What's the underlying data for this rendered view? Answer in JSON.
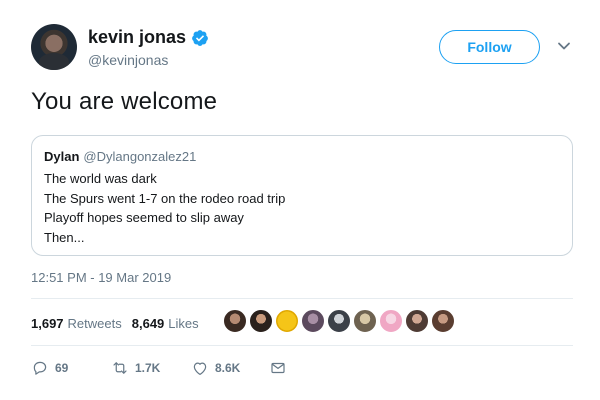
{
  "tweet": {
    "author": {
      "display_name": "kevin jonas",
      "handle": "@kevinjonas",
      "verified_icon": "verified-badge-icon"
    },
    "follow_label": "Follow",
    "text": "You are welcome",
    "quoted": {
      "display_name": "Dylan",
      "handle": "@Dylangonzalez21",
      "lines": [
        "The world was dark",
        "The Spurs went 1-7 on the rodeo road trip",
        "Playoff hopes seemed to slip away",
        "Then..."
      ]
    },
    "timestamp": "12:51 PM - 19 Mar 2019",
    "stats": {
      "retweets_count": "1,697",
      "retweets_label": "Retweets",
      "likes_count": "8,649",
      "likes_label": "Likes"
    },
    "actions": {
      "reply_count": "69",
      "retweet_count": "1.7K",
      "like_count": "8.6K"
    }
  },
  "colors": {
    "accent": "#1da1f2",
    "secondary_text": "#657786",
    "border": "#ccd6dd",
    "divider": "#e6ecf0"
  }
}
